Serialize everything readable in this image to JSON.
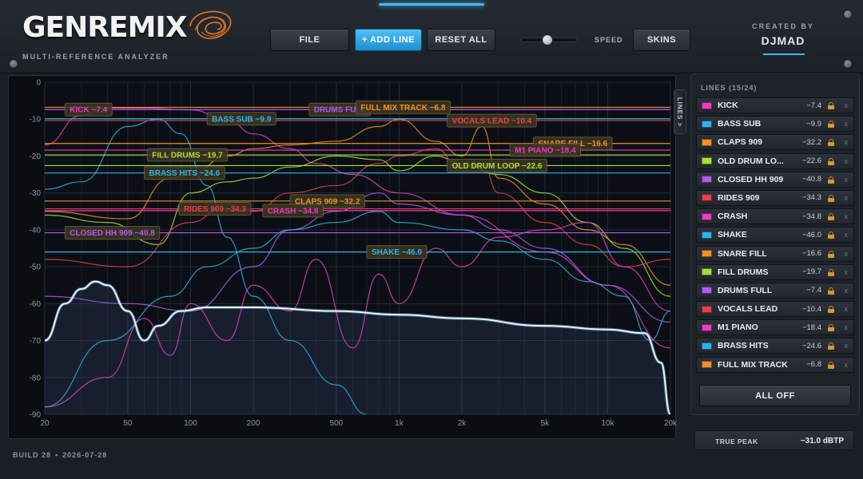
{
  "app": {
    "logo": "GENREMIX",
    "subtitle": "MULTI-REFERENCE ANALYZER",
    "created_by_label": "CREATED BY",
    "author": "DJMAD"
  },
  "toolbar": {
    "file_label": "FILE",
    "add_line_label": "+ ADD LINE",
    "reset_all_label": "RESET ALL",
    "speed_label": "SPEED",
    "speed_value": 0.45,
    "skins_label": "SKINS"
  },
  "graph": {
    "lines_tab_label": "LINES >"
  },
  "chart_data": {
    "type": "line",
    "xscale": "log",
    "xlim": [
      20,
      20000
    ],
    "ylim": [
      -90,
      0
    ],
    "grid": true,
    "x_ticks": [
      "20",
      "50",
      "100",
      "200",
      "500",
      "1k",
      "2k",
      "5k",
      "10k",
      "20k"
    ],
    "x_tick_values": [
      20,
      50,
      100,
      200,
      500,
      1000,
      2000,
      5000,
      10000,
      20000
    ],
    "y_ticks": [
      "0",
      "-10",
      "-20",
      "-30",
      "-40",
      "-50",
      "-60",
      "-70",
      "-80",
      "-90"
    ],
    "y_tick_values": [
      0,
      -10,
      -20,
      -30,
      -40,
      -50,
      -60,
      -70,
      -80,
      -90
    ],
    "reference_lines": [
      {
        "name": "KICK",
        "value": -7.4,
        "color": "#e83ec0",
        "label_text": "KICK  −7.4",
        "label_x": 25
      },
      {
        "name": "BASS SUB",
        "value": -9.9,
        "color": "#2fb4e8",
        "label_text": "BASS SUB  −9.9",
        "label_x": 120
      },
      {
        "name": "CLAPS 909",
        "value": -32.2,
        "color": "#f0902a",
        "label_text": "CLAPS 909  −32.2",
        "label_x": 300
      },
      {
        "name": "OLD DRUM LOOP",
        "value": -22.6,
        "color": "#a6e03a",
        "label_text": "OLD DRUM LOOP  −22.6",
        "label_x": 1700
      },
      {
        "name": "CLOSED HH 909",
        "value": -40.8,
        "color": "#b05ce8",
        "label_text": "CLOSED HH 909  −40.8",
        "label_x": 25
      },
      {
        "name": "RIDES 909",
        "value": -34.3,
        "color": "#e8404a",
        "label_text": "RIDES 909  −34.3",
        "label_x": 88
      },
      {
        "name": "CRASH",
        "value": -34.8,
        "color": "#e83ec0",
        "label_text": "CRASH  −34.8",
        "label_x": 222
      },
      {
        "name": "SHAKE",
        "value": -46.0,
        "color": "#2fb4e8",
        "label_text": "SHAKE  −46.0",
        "label_x": 700
      },
      {
        "name": "SNARE FILL",
        "value": -16.6,
        "color": "#f0902a",
        "label_text": "SNARE FILL  −16.6",
        "label_x": 4400
      },
      {
        "name": "FILL DRUMS",
        "value": -19.7,
        "color": "#a6e03a",
        "label_text": "FILL DRUMS  −19.7",
        "label_x": 62
      },
      {
        "name": "DRUMS FULL",
        "value": -7.4,
        "color": "#b05ce8",
        "label_text": "DRUMS FULL",
        "label_x": 370
      },
      {
        "name": "VOCALS LEAD",
        "value": -10.4,
        "color": "#e8404a",
        "label_text": "VOCALS LEAD  −10.4",
        "label_x": 1700
      },
      {
        "name": "M1 PIANO",
        "value": -18.4,
        "color": "#e83ec0",
        "label_text": "M1 PIANO  −18.4",
        "label_x": 3400
      },
      {
        "name": "BRASS HITS",
        "value": -24.6,
        "color": "#2fb4e8",
        "label_text": "BRASS HITS  −24.6",
        "label_x": 60
      },
      {
        "name": "FULL MIX TRACK",
        "value": -6.8,
        "color": "#f0902a",
        "label_text": "FULL MIX TRACK  −6.8",
        "label_x": 620
      }
    ],
    "spectra": [
      {
        "color": "#e83ec0",
        "points": [
          [
            20,
            -17
          ],
          [
            30,
            -9
          ],
          [
            40,
            -7
          ],
          [
            60,
            -7
          ],
          [
            100,
            -7.5
          ],
          [
            150,
            -10
          ],
          [
            200,
            -14
          ],
          [
            300,
            -18
          ],
          [
            400,
            -22
          ],
          [
            600,
            -25
          ],
          [
            1000,
            -30
          ],
          [
            2000,
            -36
          ],
          [
            5000,
            -46
          ],
          [
            10000,
            -55
          ],
          [
            20000,
            -72
          ]
        ]
      },
      {
        "color": "#2fb4e8",
        "points": [
          [
            20,
            -29
          ],
          [
            30,
            -27
          ],
          [
            50,
            -12
          ],
          [
            70,
            -10
          ],
          [
            90,
            -14
          ],
          [
            120,
            -28
          ],
          [
            150,
            -42
          ],
          [
            200,
            -58
          ],
          [
            300,
            -70
          ],
          [
            500,
            -82
          ],
          [
            700,
            -90
          ]
        ]
      },
      {
        "color": "#a6e03a",
        "points": [
          [
            20,
            -36
          ],
          [
            40,
            -38
          ],
          [
            70,
            -44
          ],
          [
            100,
            -30
          ],
          [
            150,
            -27
          ],
          [
            200,
            -26
          ],
          [
            300,
            -23
          ],
          [
            500,
            -20
          ],
          [
            800,
            -21
          ],
          [
            1000,
            -24
          ],
          [
            1500,
            -20
          ],
          [
            2000,
            -22
          ],
          [
            3000,
            -25
          ],
          [
            5000,
            -30
          ],
          [
            8000,
            -38
          ],
          [
            12000,
            -45
          ],
          [
            20000,
            -58
          ]
        ]
      },
      {
        "color": "#f0902a",
        "points": [
          [
            20,
            -35
          ],
          [
            50,
            -37
          ],
          [
            80,
            -26
          ],
          [
            100,
            -25
          ],
          [
            150,
            -20
          ],
          [
            200,
            -18
          ],
          [
            300,
            -17
          ],
          [
            500,
            -16
          ],
          [
            800,
            -12
          ],
          [
            1000,
            -10
          ],
          [
            1500,
            -16
          ],
          [
            2000,
            -20
          ],
          [
            2500,
            -12
          ],
          [
            3000,
            -26
          ],
          [
            5000,
            -33
          ],
          [
            8000,
            -40
          ],
          [
            12000,
            -44
          ],
          [
            20000,
            -55
          ]
        ]
      },
      {
        "color": "#e8404a",
        "points": [
          [
            20,
            -48
          ],
          [
            50,
            -50
          ],
          [
            100,
            -38
          ],
          [
            150,
            -33
          ],
          [
            200,
            -35
          ],
          [
            300,
            -30
          ],
          [
            500,
            -28
          ],
          [
            800,
            -22
          ],
          [
            1000,
            -20
          ],
          [
            1500,
            -18
          ],
          [
            2000,
            -24
          ],
          [
            2500,
            -22
          ],
          [
            3000,
            -30
          ],
          [
            5000,
            -38
          ],
          [
            8000,
            -44
          ],
          [
            12000,
            -50
          ],
          [
            20000,
            -48
          ]
        ]
      },
      {
        "color": "#b05ce8",
        "points": [
          [
            20,
            -58
          ],
          [
            50,
            -60
          ],
          [
            100,
            -62
          ],
          [
            200,
            -50
          ],
          [
            300,
            -40
          ],
          [
            500,
            -35
          ],
          [
            800,
            -30
          ],
          [
            1000,
            -33
          ],
          [
            2000,
            -36
          ],
          [
            3000,
            -40
          ],
          [
            5000,
            -45
          ],
          [
            10000,
            -55
          ],
          [
            20000,
            -65
          ]
        ]
      },
      {
        "color": "#e83ec0",
        "points": [
          [
            20,
            -88
          ],
          [
            40,
            -80
          ],
          [
            60,
            -64
          ],
          [
            80,
            -74
          ],
          [
            100,
            -60
          ],
          [
            150,
            -70
          ],
          [
            200,
            -55
          ],
          [
            300,
            -62
          ],
          [
            400,
            -48
          ],
          [
            600,
            -72
          ],
          [
            800,
            -52
          ],
          [
            1000,
            -60
          ],
          [
            1500,
            -45
          ],
          [
            2000,
            -50
          ],
          [
            3000,
            -42
          ],
          [
            5000,
            -40
          ],
          [
            8000,
            -38
          ],
          [
            12000,
            -50
          ],
          [
            20000,
            -62
          ]
        ]
      },
      {
        "color": "#2fb4e8",
        "points": [
          [
            20,
            -88
          ],
          [
            40,
            -70
          ],
          [
            80,
            -58
          ],
          [
            120,
            -50
          ],
          [
            200,
            -45
          ],
          [
            300,
            -40
          ],
          [
            500,
            -38
          ],
          [
            800,
            -35
          ],
          [
            1000,
            -38
          ],
          [
            2000,
            -40
          ],
          [
            3000,
            -43
          ],
          [
            5000,
            -48
          ],
          [
            8000,
            -54
          ],
          [
            12000,
            -58
          ],
          [
            16000,
            -70
          ],
          [
            20000,
            -62
          ]
        ]
      },
      {
        "color": "#e0f4ff",
        "points": [
          [
            20,
            -70
          ],
          [
            25,
            -60
          ],
          [
            30,
            -56
          ],
          [
            35,
            -54
          ],
          [
            40,
            -55
          ],
          [
            50,
            -62
          ],
          [
            60,
            -70
          ],
          [
            70,
            -66
          ],
          [
            90,
            -62
          ],
          [
            120,
            -61
          ],
          [
            200,
            -61
          ],
          [
            500,
            -62
          ],
          [
            1000,
            -63
          ],
          [
            2000,
            -64
          ],
          [
            5000,
            -66
          ],
          [
            10000,
            -67
          ],
          [
            15000,
            -68
          ],
          [
            18000,
            -76
          ],
          [
            20000,
            -90
          ]
        ]
      }
    ]
  },
  "panel": {
    "title": "LINES  (15/24)",
    "rows": [
      {
        "name": "KICK",
        "value": "−7.4",
        "color": "#e83ec0"
      },
      {
        "name": "BASS SUB",
        "value": "−9.9",
        "color": "#2fb4e8"
      },
      {
        "name": "CLAPS 909",
        "value": "−32.2",
        "color": "#f0902a"
      },
      {
        "name": "OLD DRUM LO...",
        "value": "−22.6",
        "color": "#a6e03a"
      },
      {
        "name": "CLOSED HH 909",
        "value": "−40.8",
        "color": "#b05ce8"
      },
      {
        "name": "RIDES 909",
        "value": "−34.3",
        "color": "#e8404a"
      },
      {
        "name": "CRASH",
        "value": "−34.8",
        "color": "#e83ec0"
      },
      {
        "name": "SHAKE",
        "value": "−46.0",
        "color": "#2fb4e8"
      },
      {
        "name": "SNARE FILL",
        "value": "−16.6",
        "color": "#f0902a"
      },
      {
        "name": "FILL DRUMS",
        "value": "−19.7",
        "color": "#a6e03a"
      },
      {
        "name": "DRUMS FULL",
        "value": "−7.4",
        "color": "#b05ce8"
      },
      {
        "name": "VOCALS LEAD",
        "value": "−10.4",
        "color": "#e8404a"
      },
      {
        "name": "M1 PIANO",
        "value": "−18.4",
        "color": "#e83ec0"
      },
      {
        "name": "BRASS HITS",
        "value": "−24.6",
        "color": "#2fb4e8"
      },
      {
        "name": "FULL MIX TRACK",
        "value": "−6.8",
        "color": "#f0902a"
      }
    ],
    "remove_glyph": "x",
    "all_off_label": "ALL OFF"
  },
  "true_peak": {
    "label": "TRUE PEAK",
    "value": "−31.0 dBTP"
  },
  "footer": {
    "build": "BUILD 28",
    "dot": "•",
    "date": "2026-07-28"
  },
  "colors": {
    "accent": "#3fb8f0",
    "background": "#1a1e25",
    "graph_bg": "#0a0d12"
  }
}
